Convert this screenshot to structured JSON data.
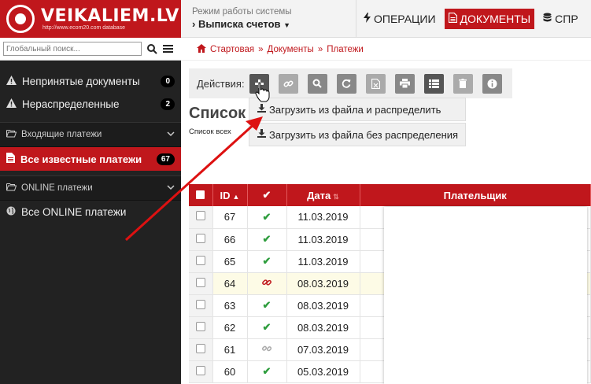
{
  "logo": {
    "title": "VEIKALIEM.LV",
    "subtitle": "http://www.ecom20.com database"
  },
  "search": {
    "placeholder": "Глобальный поиск..."
  },
  "sidebar": {
    "items": [
      {
        "label": "Непринятые документы",
        "count": "0",
        "icon": "warning-icon"
      },
      {
        "label": "Нераспределенные",
        "count": "2",
        "icon": "warning-icon"
      }
    ],
    "section1": "Входящие платежи",
    "active": {
      "label": "Все известные платежи",
      "count": "67"
    },
    "section2": "ONLINE платежи",
    "online": {
      "label": "Все ONLINE платежи"
    }
  },
  "topbar": {
    "mode_title": "Режим работы системы",
    "mode_value": "Выписка счетов",
    "nav": [
      {
        "label": "ОПЕРАЦИИ",
        "icon": "bolt-icon"
      },
      {
        "label": "ДОКУМЕНТЫ",
        "icon": "document-icon"
      },
      {
        "label": "СПР",
        "icon": "database-icon"
      }
    ]
  },
  "breadcrumb": [
    "Стартовая",
    "Документы",
    "Платежи"
  ],
  "actions": {
    "label": "Действия:"
  },
  "dropdown": [
    "Загрузить из файла и распределить",
    "Загрузить из файла без распределения"
  ],
  "page": {
    "title": "Список",
    "subtitle": "Список всех"
  },
  "table": {
    "headers": {
      "id": "ID",
      "date": "Дата",
      "payer": "Плательщик"
    },
    "rows": [
      {
        "id": "67",
        "status": "ok",
        "date": "11.03.2019"
      },
      {
        "id": "66",
        "status": "ok",
        "date": "11.03.2019"
      },
      {
        "id": "65",
        "status": "ok",
        "date": "11.03.2019"
      },
      {
        "id": "64",
        "status": "link-red",
        "date": "08.03.2019"
      },
      {
        "id": "63",
        "status": "ok",
        "date": "08.03.2019"
      },
      {
        "id": "62",
        "status": "ok",
        "date": "08.03.2019"
      },
      {
        "id": "61",
        "status": "link-grey",
        "date": "07.03.2019"
      },
      {
        "id": "60",
        "status": "ok",
        "date": "05.03.2019"
      }
    ]
  },
  "colors": {
    "brand": "#c0171c",
    "sidebar": "#222222",
    "ok": "#2e9d3d"
  }
}
